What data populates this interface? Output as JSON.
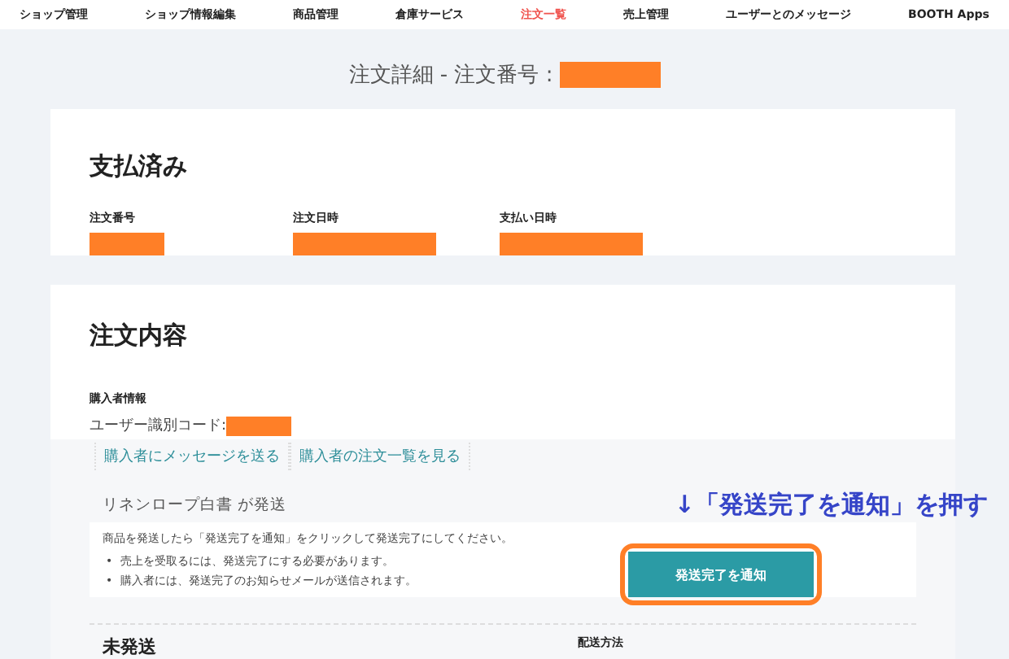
{
  "nav": {
    "items": [
      {
        "label": "ショップ管理",
        "selected": false
      },
      {
        "label": "ショップ情報編集",
        "selected": false
      },
      {
        "label": "商品管理",
        "selected": false
      },
      {
        "label": "倉庫サービス",
        "selected": false
      },
      {
        "label": "注文一覧",
        "selected": true
      },
      {
        "label": "売上管理",
        "selected": false
      },
      {
        "label": "ユーザーとのメッセージ",
        "selected": false
      },
      {
        "label": "BOOTH Apps",
        "selected": false
      }
    ]
  },
  "page_title": "注文詳細 - 注文番号 :",
  "status": {
    "heading": "支払済み",
    "fields": [
      {
        "label": "注文番号"
      },
      {
        "label": "注文日時"
      },
      {
        "label": "支払い日時"
      }
    ]
  },
  "order": {
    "heading": "注文内容",
    "buyer_label": "購入者情報",
    "buyer_code": "ユーザー識別コード:",
    "links": [
      "購入者にメッセージを送る",
      "購入者の注文一覧を見る"
    ],
    "shipment": {
      "title": "リネンロープ白書 が発送",
      "instruction": "商品を発送したら「発送完了を通知」をクリックして発送完了にしてください。",
      "notes": [
        {
          "bullet": "•",
          "text": "売上を受取るには、発送完了にする必要があります。"
        },
        {
          "bullet": "•",
          "text": "購入者には、発送完了のお知らせメールが送信されます。"
        }
      ],
      "button": "発送完了を通知",
      "status": "未発送",
      "method_label": "配送方法"
    }
  },
  "annotation": "↓「発送完了を通知」を押す"
}
